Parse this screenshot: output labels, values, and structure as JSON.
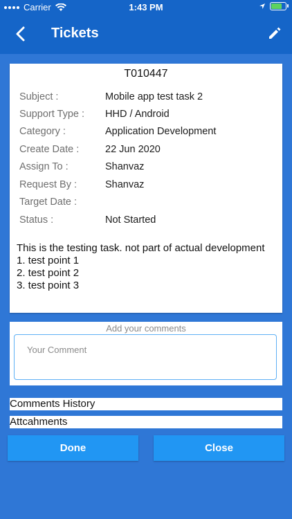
{
  "status_bar": {
    "carrier": "Carrier",
    "time": "1:43 PM"
  },
  "header": {
    "title": "Tickets"
  },
  "ticket": {
    "id": "T010447",
    "fields": [
      {
        "label": "Subject :",
        "value": "Mobile app test task 2"
      },
      {
        "label": "Support Type :",
        "value": "HHD / Android"
      },
      {
        "label": "Category :",
        "value": "Application Development"
      },
      {
        "label": "Create Date :",
        "value": "22 Jun 2020"
      },
      {
        "label": "Assign To :",
        "value": "Shanvaz"
      },
      {
        "label": "Request By :",
        "value": "Shanvaz"
      },
      {
        "label": "Target Date :",
        "value": ""
      },
      {
        "label": "Status :",
        "value": "Not Started"
      }
    ],
    "description": "This is the testing task. not part of actual development\n1. test point 1\n2. test point 2\n3. test point 3"
  },
  "comments": {
    "heading": "Add your comments",
    "placeholder": "Your Comment"
  },
  "sections": {
    "history": "Comments History",
    "attachments": "Attcahments"
  },
  "buttons": {
    "done": "Done",
    "close": "Close"
  },
  "colors": {
    "header": "#1565c8",
    "background": "#2f77d6",
    "button": "#2196f3",
    "input_border": "#5eb0f5"
  }
}
